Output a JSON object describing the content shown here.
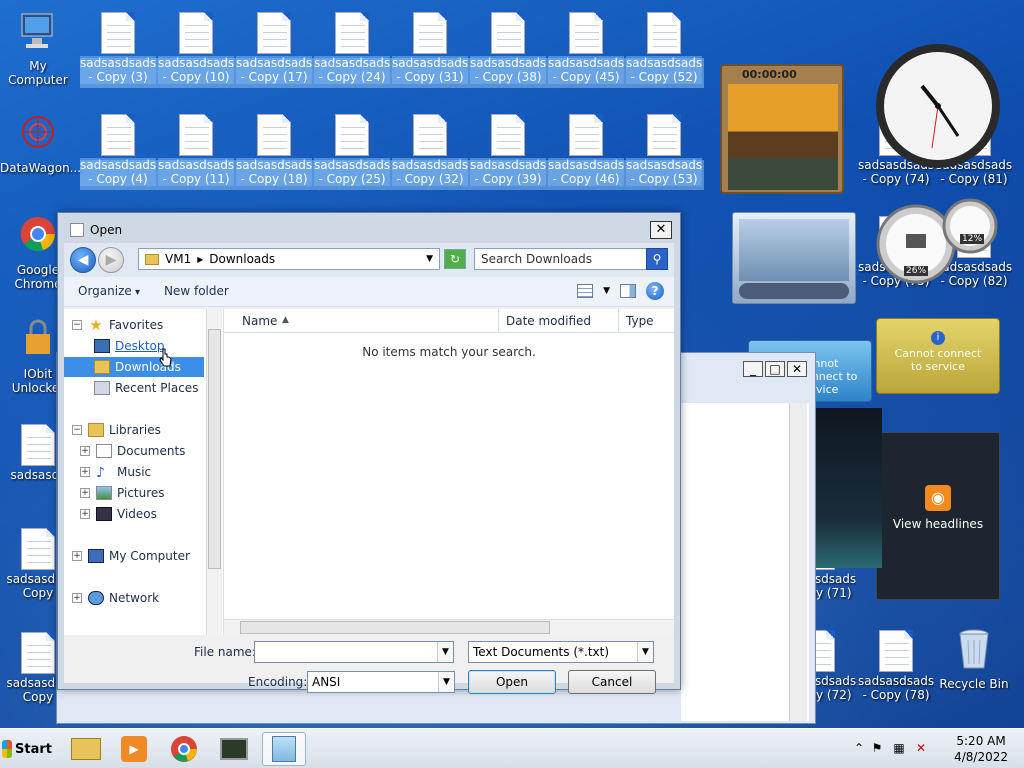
{
  "desktop": {
    "left_icons": [
      {
        "label": "My Computer"
      },
      {
        "label": "DataWagon..."
      },
      {
        "label": "Google Chrome"
      },
      {
        "label": "IObit Unlocker"
      },
      {
        "label": "sadsasds"
      },
      {
        "label": "sadsasds - Copy"
      },
      {
        "label": "sadsasds - Copy"
      }
    ],
    "row1": [
      {
        "l1": "sadsasdsads...",
        "l2": "- Copy (3)"
      },
      {
        "l1": "sadsasdsads...",
        "l2": "- Copy (10)"
      },
      {
        "l1": "sadsasdsads...",
        "l2": "- Copy (17)"
      },
      {
        "l1": "sadsasdsads...",
        "l2": "- Copy (24)"
      },
      {
        "l1": "sadsasdsads...",
        "l2": "- Copy (31)"
      },
      {
        "l1": "sadsasdsads...",
        "l2": "- Copy (38)"
      },
      {
        "l1": "sadsasdsads...",
        "l2": "- Copy (45)"
      },
      {
        "l1": "sadsasdsads...",
        "l2": "- Copy (52)"
      }
    ],
    "row2": [
      {
        "l1": "sadsasdsads...",
        "l2": "- Copy (4)"
      },
      {
        "l1": "sadsasdsads...",
        "l2": "- Copy (11)"
      },
      {
        "l1": "sadsasdsads...",
        "l2": "- Copy (18)"
      },
      {
        "l1": "sadsasdsads...",
        "l2": "- Copy (25)"
      },
      {
        "l1": "sadsasdsads...",
        "l2": "- Copy (32)"
      },
      {
        "l1": "sadsasdsads...",
        "l2": "- Copy (39)"
      },
      {
        "l1": "sadsasdsads...",
        "l2": "- Copy (46)"
      },
      {
        "l1": "sadsasdsads...",
        "l2": "- Copy (53)"
      }
    ],
    "right_col": [
      {
        "l1": "sadsasdsads...",
        "l2": "- Copy (74)"
      },
      {
        "l1": "sadsasdsads...",
        "l2": "- Copy (81)"
      },
      {
        "l1": "sadsasdsads...",
        "l2": "- Copy (75)"
      },
      {
        "l1": "sadsasdsads...",
        "l2": "- Copy (82)"
      },
      {
        "l1": "sadsasdsads...",
        "l2": "- Copy (71)"
      },
      {
        "l1": "sadsasdsads...",
        "l2": "- Copy (72)"
      },
      {
        "l1": "sadsasdsads...",
        "l2": "- Copy (78)"
      }
    ],
    "recycle_bin": "Recycle Bin"
  },
  "gadgets": {
    "puzzle_timer": "00:00:00",
    "cpu_percent": "26%",
    "mem_percent": "12%",
    "weather_msg": "Cannot connect to service",
    "weather_msg2": "Cannot connect to service",
    "feed_label": "View headlines"
  },
  "dialog": {
    "title": "Open",
    "close": "✕",
    "address": {
      "root": "VM1",
      "sep": "▸",
      "folder": "Downloads"
    },
    "search_placeholder": "Search Downloads",
    "toolbar": {
      "organize": "Organize",
      "new_folder": "New folder"
    },
    "nav": {
      "favorites": "Favorites",
      "desktop": "Desktop",
      "downloads": "Downloads",
      "recent": "Recent Places",
      "libraries": "Libraries",
      "documents": "Documents",
      "music": "Music",
      "pictures": "Pictures",
      "videos": "Videos",
      "my_computer": "My Computer",
      "network": "Network"
    },
    "columns": {
      "name": "Name",
      "date": "Date modified",
      "type": "Type"
    },
    "empty_message": "No items match your search.",
    "file_name_label": "File name:",
    "file_name_value": "",
    "file_type": "Text Documents (*.txt)",
    "encoding_label": "Encoding:",
    "encoding_value": "ANSI",
    "open_button": "Open",
    "cancel_button": "Cancel"
  },
  "taskbar": {
    "start_label": "Start",
    "time": "5:20 AM",
    "date": "4/8/2022"
  }
}
